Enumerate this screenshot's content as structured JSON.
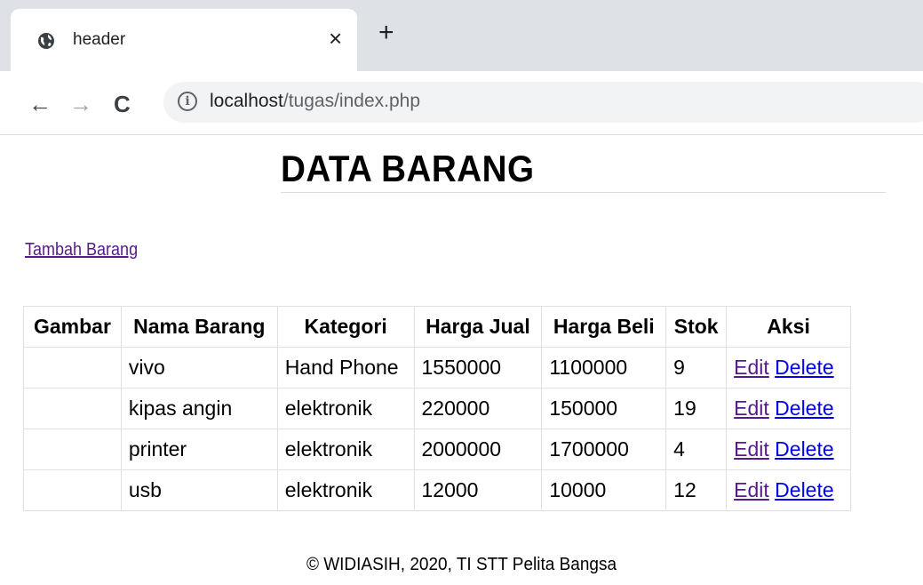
{
  "browser": {
    "tab_title": "header",
    "tab_close": "×",
    "new_tab": "+",
    "url_host": "localhost",
    "url_path": "/tugas/index.php",
    "nav": {
      "back": "←",
      "forward": "→",
      "reload": "C"
    },
    "info": "i"
  },
  "page": {
    "title": "DATA BARANG",
    "add_link": "Tambah Barang",
    "footer": "© WIDIASIH, 2020, TI STT Pelita Bangsa"
  },
  "table": {
    "headers": [
      "Gambar",
      "Nama Barang",
      "Kategori",
      "Harga Jual",
      "Harga Beli",
      "Stok",
      "Aksi"
    ],
    "rows": [
      {
        "gambar": "",
        "nama": "vivo",
        "kategori": "Hand Phone",
        "harga_jual": "1550000",
        "harga_beli": "1100000",
        "stok": "9"
      },
      {
        "gambar": "",
        "nama": "kipas angin",
        "kategori": "elektronik",
        "harga_jual": "220000",
        "harga_beli": "150000",
        "stok": "19"
      },
      {
        "gambar": "",
        "nama": "printer",
        "kategori": "elektronik",
        "harga_jual": "2000000",
        "harga_beli": "1700000",
        "stok": "4"
      },
      {
        "gambar": "",
        "nama": "usb",
        "kategori": "elektronik",
        "harga_jual": "12000",
        "harga_beli": "10000",
        "stok": "12"
      }
    ],
    "edit_label": "Edit",
    "delete_label": "Delete"
  }
}
